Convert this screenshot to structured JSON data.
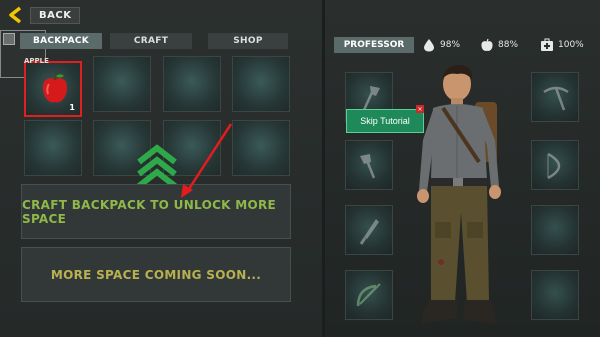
{
  "header": {
    "back_label": "BACK"
  },
  "tabs": [
    {
      "label": "BACKPACK",
      "active": true
    },
    {
      "label": "CRAFT",
      "active": false
    },
    {
      "label": "SHOP",
      "active": false
    }
  ],
  "inventory": {
    "selected_item": {
      "name": "APPLE",
      "quantity": "1"
    }
  },
  "banners": {
    "craft_backpack": "CRAFT BACKPACK TO UNLOCK MORE SPACE",
    "more_space": "MORE SPACE COMING SOON..."
  },
  "character": {
    "tab_label": "PROFESSOR",
    "stats": [
      {
        "icon": "water-drop-icon",
        "value": "98%"
      },
      {
        "icon": "apple-icon",
        "value": "88%"
      },
      {
        "icon": "medkit-icon",
        "value": "100%"
      }
    ]
  },
  "tutorial": {
    "skip_label": "Skip Tutorial"
  },
  "colors": {
    "banner_text_primary": "#8fb84a",
    "banner_text_secondary": "#b9b050",
    "accent_green": "#2fa84a",
    "highlight_red": "#e02020"
  }
}
